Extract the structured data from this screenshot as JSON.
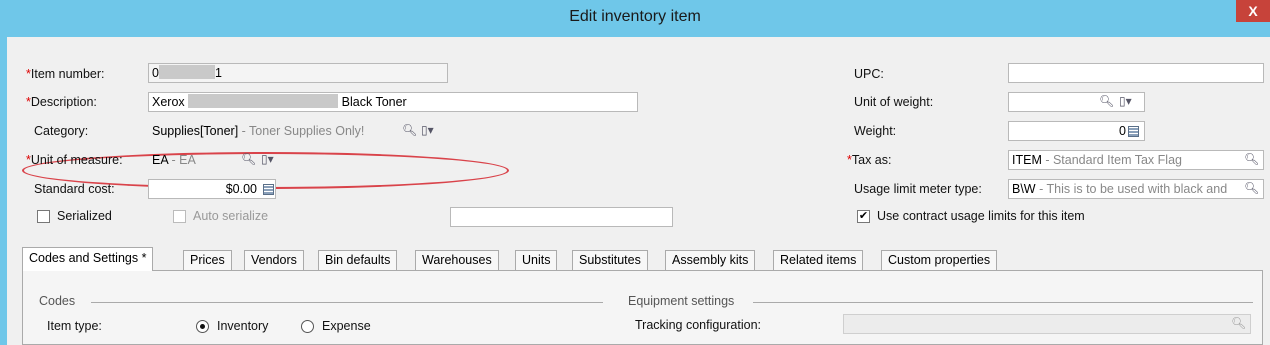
{
  "window": {
    "title": "Edit inventory item",
    "close_label": "X"
  },
  "left": {
    "item_number_label": "Item number:",
    "item_number_prefix": "0",
    "item_number_suffix": "1",
    "description_label": "Description:",
    "description_prefix": "Xerox",
    "description_suffix": "Black Toner",
    "category_label": "Category:",
    "category_value": "Supplies[Toner]",
    "category_hint": " - Toner Supplies Only!",
    "unit_of_measure_label": "Unit of measure:",
    "unit_of_measure_value": "EA",
    "unit_of_measure_hint": " - EA",
    "standard_cost_label": "Standard cost:",
    "standard_cost_value": "$0.00",
    "serialized_label": "Serialized",
    "auto_serialize_label": "Auto serialize",
    "required_marker": "*"
  },
  "right": {
    "upc_label": "UPC:",
    "upc_value": "",
    "unit_of_weight_label": "Unit of weight:",
    "weight_label": "Weight:",
    "weight_value": "0",
    "tax_as_label": "Tax as:",
    "tax_as_value": "ITEM",
    "tax_as_hint": " - Standard Item Tax Flag",
    "usage_limit_label": "Usage limit meter type:",
    "usage_limit_value": "B\\W",
    "usage_limit_hint": " - This is to be used with black and",
    "use_contract_label": "Use contract usage limits for this item",
    "use_contract_checked": true
  },
  "tabs": [
    {
      "label": "Codes and Settings  *",
      "active": true
    },
    {
      "label": "Prices"
    },
    {
      "label": "Vendors"
    },
    {
      "label": "Bin defaults"
    },
    {
      "label": "Warehouses"
    },
    {
      "label": "Units"
    },
    {
      "label": "Substitutes"
    },
    {
      "label": "Assembly kits"
    },
    {
      "label": "Related items"
    },
    {
      "label": "Custom properties"
    }
  ],
  "panel": {
    "codes_title": "Codes",
    "item_type_label": "Item type:",
    "item_type_options": [
      "Inventory",
      "Expense"
    ],
    "item_type_selected": "Inventory",
    "equipment_title": "Equipment settings",
    "tracking_label": "Tracking configuration:",
    "tracking_value": ""
  },
  "icons": {
    "search": "search-icon",
    "lookup": "lookup-dropdown-icon",
    "calculator": "calculator-icon"
  },
  "colors": {
    "titlebar": "#6fc7e9",
    "close": "#c7433a",
    "highlight_ellipse": "#d9434a",
    "required": "#dd0000"
  }
}
